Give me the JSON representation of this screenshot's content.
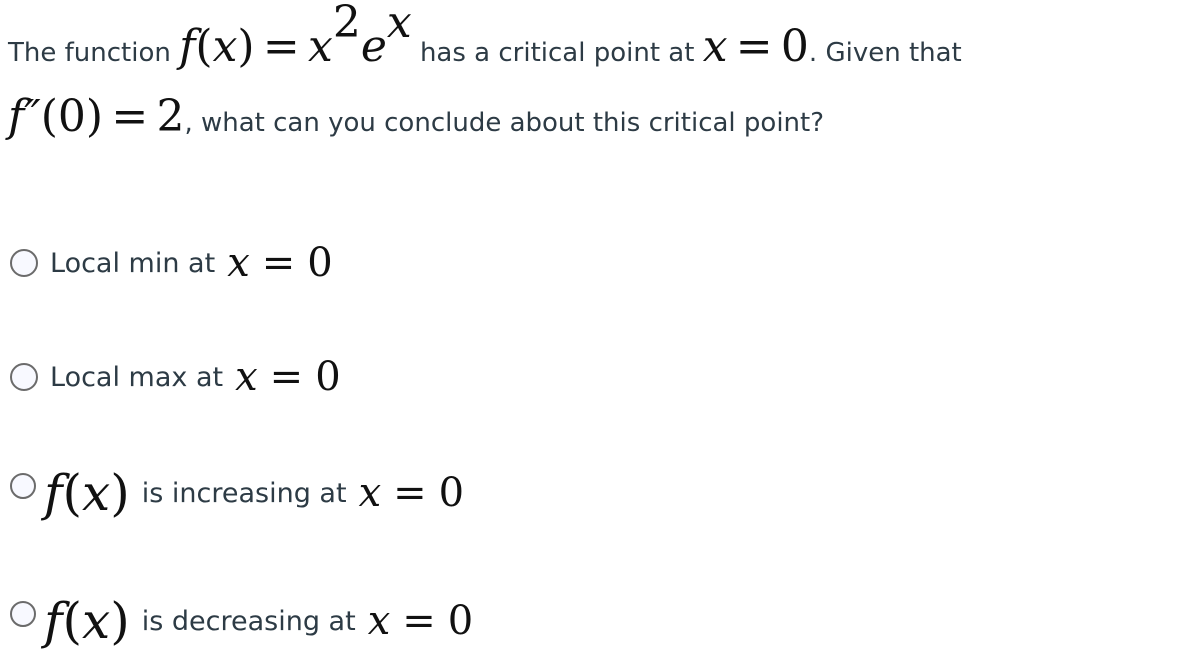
{
  "question": {
    "line1": {
      "text_before": "The function",
      "func": "f",
      "paren_open": "(",
      "var": "x",
      "paren_close": ")",
      "equals": "=",
      "base_x": "x",
      "exp_2": "2",
      "base_e": "e",
      "exp_x": "x",
      "text_middle": "has a critical point at",
      "crit_var": "x",
      "crit_equals": "=",
      "crit_value": "0",
      "text_after": ". Given that"
    },
    "line2": {
      "func": "f″",
      "arg": "(0)",
      "equals": "=",
      "value": "2",
      "text_after": ", what can you conclude about this critical point?"
    }
  },
  "options": [
    {
      "label": "Local min at",
      "var": "x",
      "equals": "=",
      "value": "0",
      "selected": false
    },
    {
      "label": "Local max at",
      "var": "x",
      "equals": "=",
      "value": "0",
      "selected": false
    },
    {
      "func": "f",
      "paren_open": "(",
      "arg": "x",
      "paren_close": ")",
      "label": "is increasing at",
      "var": "x",
      "equals": "=",
      "value": "0",
      "selected": false
    },
    {
      "func": "f",
      "paren_open": "(",
      "arg": "x",
      "paren_close": ")",
      "label": "is decreasing at",
      "var": "x",
      "equals": "=",
      "value": "0",
      "selected": false
    }
  ]
}
